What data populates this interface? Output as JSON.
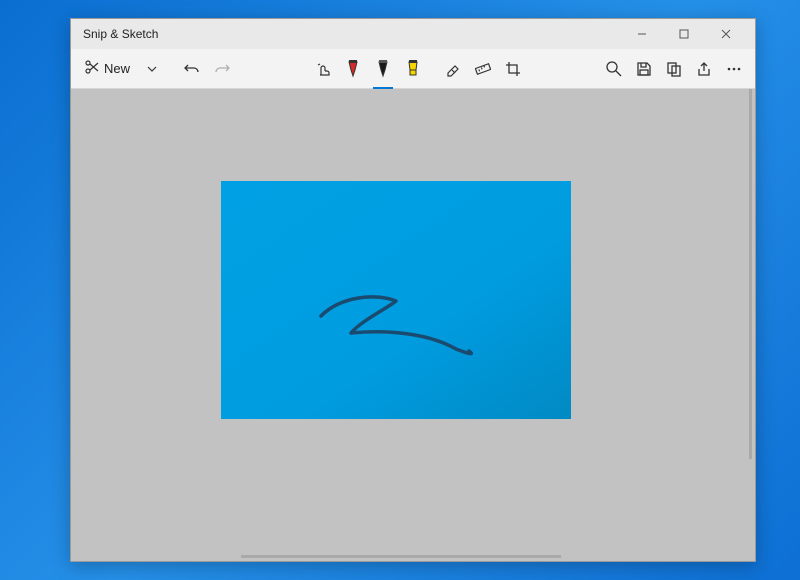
{
  "window": {
    "title": "Snip & Sketch"
  },
  "window_controls": {
    "minimize": "minimize",
    "maximize": "maximize",
    "close": "close"
  },
  "toolbar": {
    "new_label": "New",
    "snip_dropdown": "snip-dropdown",
    "undo": "undo",
    "redo": "redo",
    "touch_writing": "touch-writing",
    "ballpoint_pen": "ballpoint-pen",
    "pencil": "pencil",
    "highlighter": "highlighter",
    "eraser": "eraser",
    "ruler": "ruler",
    "crop": "crop",
    "zoom": "zoom",
    "save": "save",
    "copy": "copy",
    "share": "share",
    "more": "more"
  },
  "colors": {
    "ballpoint": "#d52a2a",
    "pencil": "#1a1a1a",
    "highlighter": "#f5d400",
    "accent": "#0078d4"
  },
  "state": {
    "selected_tool": "pencil",
    "undo_enabled": true,
    "redo_enabled": false
  },
  "canvas": {
    "background": "#00a1e4",
    "stroke_color": "#1a4a6e"
  }
}
